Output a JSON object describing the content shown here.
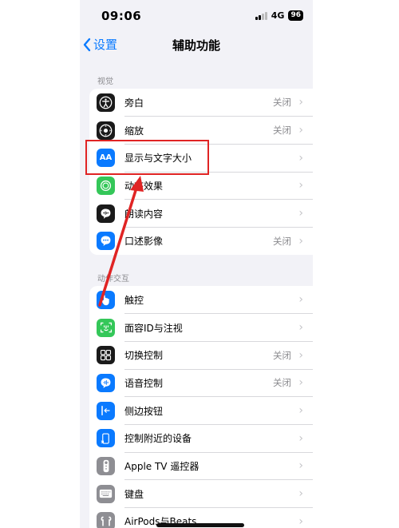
{
  "status": {
    "time": "09:06",
    "network": "4G",
    "battery": "96"
  },
  "nav": {
    "back_label": "设置",
    "title": "辅助功能"
  },
  "sections": [
    {
      "header": "视觉",
      "items": [
        {
          "name": "voiceover",
          "label": "旁白",
          "value": "关闭",
          "icon": "voiceover-icon",
          "color": "#1a1a1a"
        },
        {
          "name": "zoom",
          "label": "缩放",
          "value": "关闭",
          "icon": "zoom-icon",
          "color": "#1a1a1a"
        },
        {
          "name": "display-text-size",
          "label": "显示与文字大小",
          "value": "",
          "icon": "text-size-icon",
          "color": "#0a7aff"
        },
        {
          "name": "motion",
          "label": "动态效果",
          "value": "",
          "icon": "motion-icon",
          "color": "#34c759"
        },
        {
          "name": "spoken-content",
          "label": "朗读内容",
          "value": "",
          "icon": "speech-bubble-icon",
          "color": "#1a1a1a"
        },
        {
          "name": "audio-descriptions",
          "label": "口述影像",
          "value": "关闭",
          "icon": "audio-description-icon",
          "color": "#0a7aff"
        }
      ]
    },
    {
      "header": "动作交互",
      "items": [
        {
          "name": "touch",
          "label": "触控",
          "value": "",
          "icon": "hand-touch-icon",
          "color": "#0a7aff"
        },
        {
          "name": "face-id",
          "label": "面容ID与注视",
          "value": "",
          "icon": "face-id-icon",
          "color": "#34c759"
        },
        {
          "name": "switch-control",
          "label": "切换控制",
          "value": "关闭",
          "icon": "switch-control-icon",
          "color": "#1a1a1a"
        },
        {
          "name": "voice-control",
          "label": "语音控制",
          "value": "关闭",
          "icon": "voice-control-icon",
          "color": "#0a7aff"
        },
        {
          "name": "side-button",
          "label": "侧边按钮",
          "value": "",
          "icon": "side-button-icon",
          "color": "#0a7aff"
        },
        {
          "name": "control-nearby-devices",
          "label": "控制附近的设备",
          "value": "",
          "icon": "nearby-devices-icon",
          "color": "#0a7aff"
        },
        {
          "name": "apple-tv-remote",
          "label": "Apple TV 遥控器",
          "value": "",
          "icon": "tv-remote-icon",
          "color": "#8e8e93"
        },
        {
          "name": "keyboards",
          "label": "键盘",
          "value": "",
          "icon": "keyboard-icon",
          "color": "#8e8e93"
        },
        {
          "name": "airpods-beats",
          "label": "AirPods与Beats",
          "value": "",
          "icon": "airpods-icon",
          "color": "#8e8e93"
        }
      ]
    }
  ],
  "chevron": "›",
  "annotation_colors": {
    "highlight": "#e02424",
    "arrow": "#e02424"
  }
}
